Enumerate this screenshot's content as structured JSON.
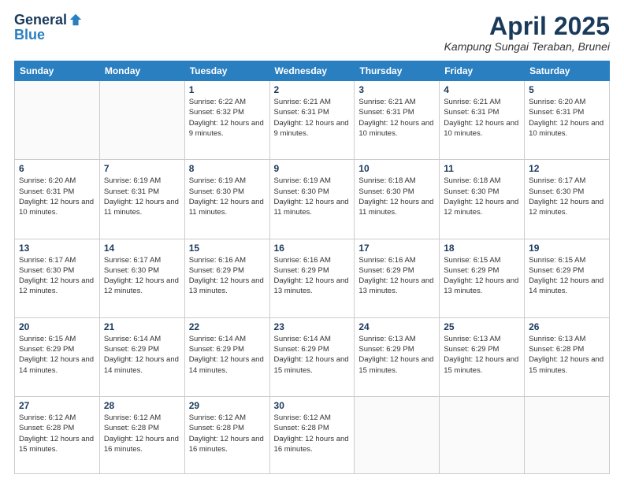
{
  "header": {
    "logo_general": "General",
    "logo_blue": "Blue",
    "month_title": "April 2025",
    "location": "Kampung Sungai Teraban, Brunei"
  },
  "days_of_week": [
    "Sunday",
    "Monday",
    "Tuesday",
    "Wednesday",
    "Thursday",
    "Friday",
    "Saturday"
  ],
  "weeks": [
    [
      {
        "day": "",
        "info": ""
      },
      {
        "day": "",
        "info": ""
      },
      {
        "day": "1",
        "info": "Sunrise: 6:22 AM\nSunset: 6:32 PM\nDaylight: 12 hours and 9 minutes."
      },
      {
        "day": "2",
        "info": "Sunrise: 6:21 AM\nSunset: 6:31 PM\nDaylight: 12 hours and 9 minutes."
      },
      {
        "day": "3",
        "info": "Sunrise: 6:21 AM\nSunset: 6:31 PM\nDaylight: 12 hours and 10 minutes."
      },
      {
        "day": "4",
        "info": "Sunrise: 6:21 AM\nSunset: 6:31 PM\nDaylight: 12 hours and 10 minutes."
      },
      {
        "day": "5",
        "info": "Sunrise: 6:20 AM\nSunset: 6:31 PM\nDaylight: 12 hours and 10 minutes."
      }
    ],
    [
      {
        "day": "6",
        "info": "Sunrise: 6:20 AM\nSunset: 6:31 PM\nDaylight: 12 hours and 10 minutes."
      },
      {
        "day": "7",
        "info": "Sunrise: 6:19 AM\nSunset: 6:31 PM\nDaylight: 12 hours and 11 minutes."
      },
      {
        "day": "8",
        "info": "Sunrise: 6:19 AM\nSunset: 6:30 PM\nDaylight: 12 hours and 11 minutes."
      },
      {
        "day": "9",
        "info": "Sunrise: 6:19 AM\nSunset: 6:30 PM\nDaylight: 12 hours and 11 minutes."
      },
      {
        "day": "10",
        "info": "Sunrise: 6:18 AM\nSunset: 6:30 PM\nDaylight: 12 hours and 11 minutes."
      },
      {
        "day": "11",
        "info": "Sunrise: 6:18 AM\nSunset: 6:30 PM\nDaylight: 12 hours and 12 minutes."
      },
      {
        "day": "12",
        "info": "Sunrise: 6:17 AM\nSunset: 6:30 PM\nDaylight: 12 hours and 12 minutes."
      }
    ],
    [
      {
        "day": "13",
        "info": "Sunrise: 6:17 AM\nSunset: 6:30 PM\nDaylight: 12 hours and 12 minutes."
      },
      {
        "day": "14",
        "info": "Sunrise: 6:17 AM\nSunset: 6:30 PM\nDaylight: 12 hours and 12 minutes."
      },
      {
        "day": "15",
        "info": "Sunrise: 6:16 AM\nSunset: 6:29 PM\nDaylight: 12 hours and 13 minutes."
      },
      {
        "day": "16",
        "info": "Sunrise: 6:16 AM\nSunset: 6:29 PM\nDaylight: 12 hours and 13 minutes."
      },
      {
        "day": "17",
        "info": "Sunrise: 6:16 AM\nSunset: 6:29 PM\nDaylight: 12 hours and 13 minutes."
      },
      {
        "day": "18",
        "info": "Sunrise: 6:15 AM\nSunset: 6:29 PM\nDaylight: 12 hours and 13 minutes."
      },
      {
        "day": "19",
        "info": "Sunrise: 6:15 AM\nSunset: 6:29 PM\nDaylight: 12 hours and 14 minutes."
      }
    ],
    [
      {
        "day": "20",
        "info": "Sunrise: 6:15 AM\nSunset: 6:29 PM\nDaylight: 12 hours and 14 minutes."
      },
      {
        "day": "21",
        "info": "Sunrise: 6:14 AM\nSunset: 6:29 PM\nDaylight: 12 hours and 14 minutes."
      },
      {
        "day": "22",
        "info": "Sunrise: 6:14 AM\nSunset: 6:29 PM\nDaylight: 12 hours and 14 minutes."
      },
      {
        "day": "23",
        "info": "Sunrise: 6:14 AM\nSunset: 6:29 PM\nDaylight: 12 hours and 15 minutes."
      },
      {
        "day": "24",
        "info": "Sunrise: 6:13 AM\nSunset: 6:29 PM\nDaylight: 12 hours and 15 minutes."
      },
      {
        "day": "25",
        "info": "Sunrise: 6:13 AM\nSunset: 6:29 PM\nDaylight: 12 hours and 15 minutes."
      },
      {
        "day": "26",
        "info": "Sunrise: 6:13 AM\nSunset: 6:28 PM\nDaylight: 12 hours and 15 minutes."
      }
    ],
    [
      {
        "day": "27",
        "info": "Sunrise: 6:12 AM\nSunset: 6:28 PM\nDaylight: 12 hours and 15 minutes."
      },
      {
        "day": "28",
        "info": "Sunrise: 6:12 AM\nSunset: 6:28 PM\nDaylight: 12 hours and 16 minutes."
      },
      {
        "day": "29",
        "info": "Sunrise: 6:12 AM\nSunset: 6:28 PM\nDaylight: 12 hours and 16 minutes."
      },
      {
        "day": "30",
        "info": "Sunrise: 6:12 AM\nSunset: 6:28 PM\nDaylight: 12 hours and 16 minutes."
      },
      {
        "day": "",
        "info": ""
      },
      {
        "day": "",
        "info": ""
      },
      {
        "day": "",
        "info": ""
      }
    ]
  ]
}
